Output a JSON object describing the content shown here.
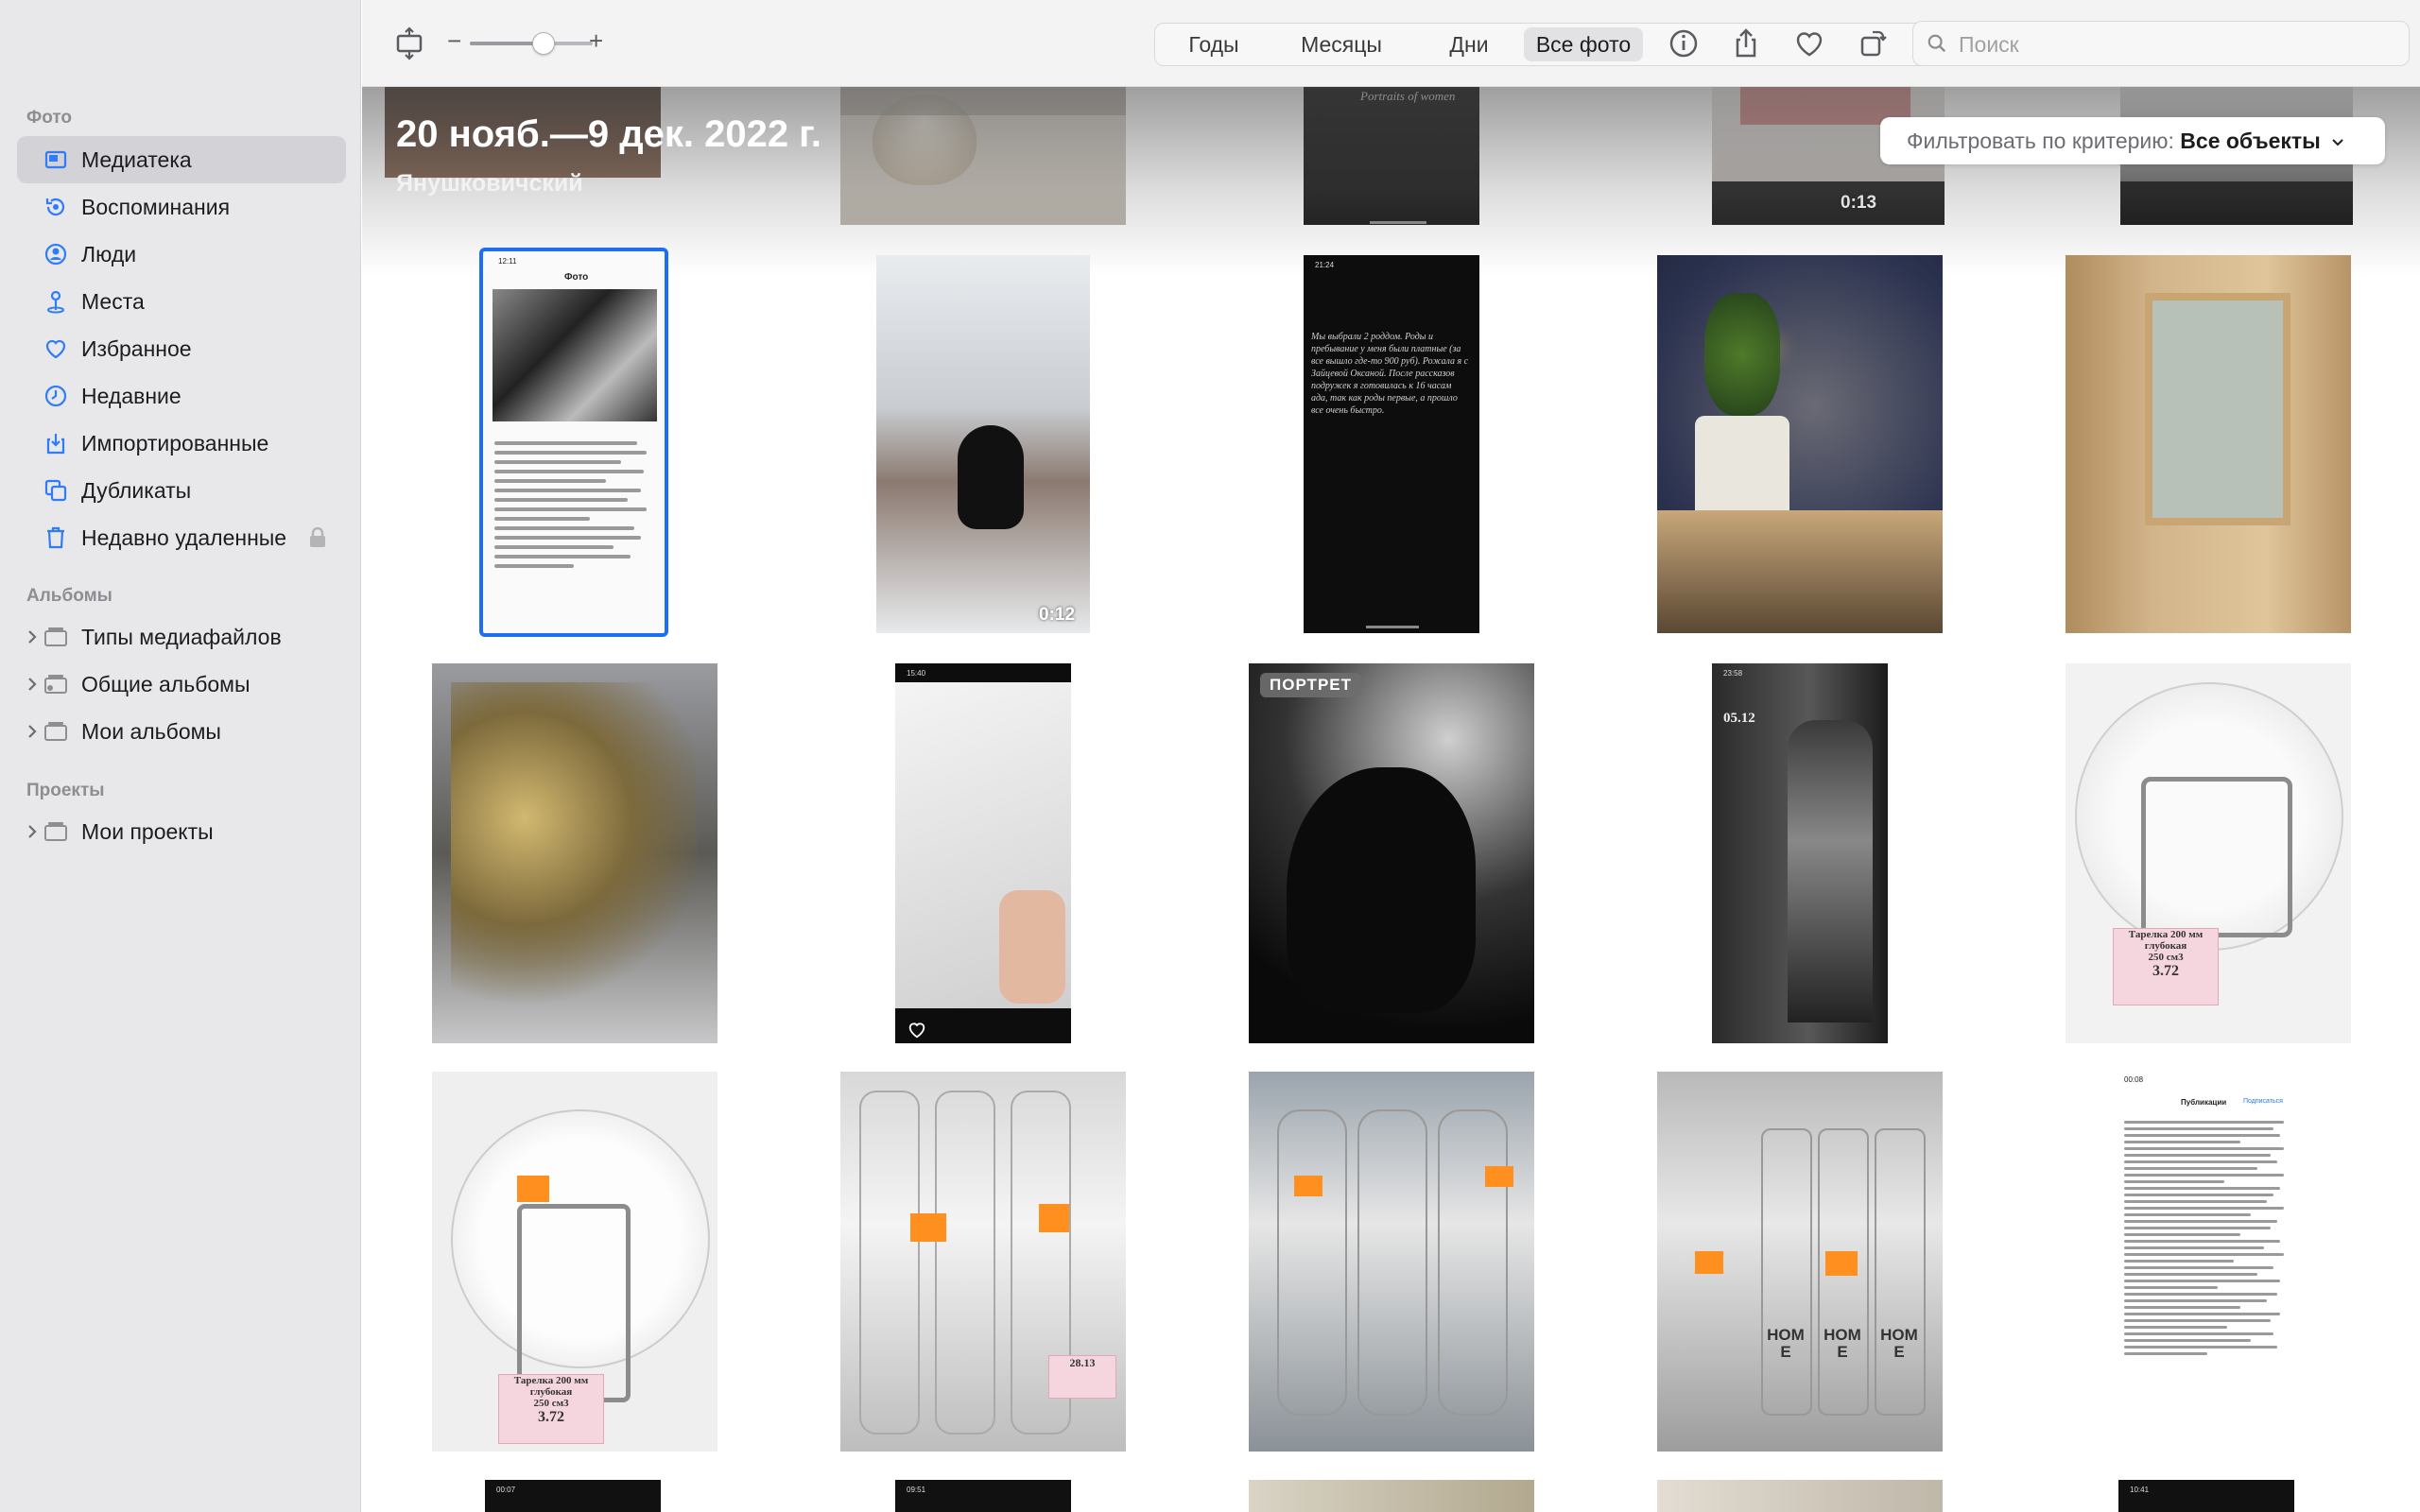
{
  "sidebar": {
    "section_photos": "Фото",
    "items": [
      {
        "label": "Медиатека",
        "icon": "library-icon"
      },
      {
        "label": "Воспоминания",
        "icon": "memories-icon"
      },
      {
        "label": "Люди",
        "icon": "people-icon"
      },
      {
        "label": "Места",
        "icon": "places-icon"
      },
      {
        "label": "Избранное",
        "icon": "heart-icon"
      },
      {
        "label": "Недавние",
        "icon": "clock-icon"
      },
      {
        "label": "Импортированные",
        "icon": "import-icon"
      },
      {
        "label": "Дубликаты",
        "icon": "duplicates-icon"
      },
      {
        "label": "Недавно удаленные",
        "icon": "trash-icon"
      }
    ],
    "section_albums": "Альбомы",
    "albums": [
      {
        "label": "Типы медиафайлов"
      },
      {
        "label": "Общие альбомы"
      },
      {
        "label": "Мои альбомы"
      }
    ],
    "section_projects": "Проекты",
    "projects": [
      {
        "label": "Мои проекты"
      }
    ]
  },
  "toolbar": {
    "zoom_minus": "−",
    "zoom_plus": "+",
    "zoom_level": 0.6,
    "segments": [
      "Годы",
      "Месяцы",
      "Дни",
      "Все фото"
    ],
    "active_segment": "Все фото",
    "search_placeholder": "Поиск"
  },
  "header": {
    "date_range": "20 нояб.—9 дек. 2022 г.",
    "place": "Янушковичский",
    "filter_label": "Фильтровать по критерию:",
    "filter_value": "Все объекты"
  },
  "grid": {
    "top_row_duration": "0:13",
    "row1_duration": "0:12",
    "portrait_badge": "ПОРТРЕТ",
    "story_date": "05.12",
    "ig_title": "Фото",
    "pub_title": "Публикации",
    "pub_follow": "Подписаться",
    "story_header": "Portraits of women",
    "price_title": "Тарелка 200 мм глубокая",
    "price_sub": "250 см3",
    "price_value": "3.72",
    "bottle_word": "HOME",
    "bottle_price": "28.13",
    "story_text": "Мы выбрали 2 роддом. Роды и пребывание у меня были платные (за все вышло где-то 900 руб). Рожала я с Зайцевой Оксаной. После рассказов подружек я готовилась к 16 часам ада, так как роды первые, а прошло все очень быстро.",
    "status_times": [
      "12:11",
      "21:24",
      "15:40",
      "23:58",
      "00:08",
      "00:07",
      "09:51",
      "10:41"
    ]
  }
}
